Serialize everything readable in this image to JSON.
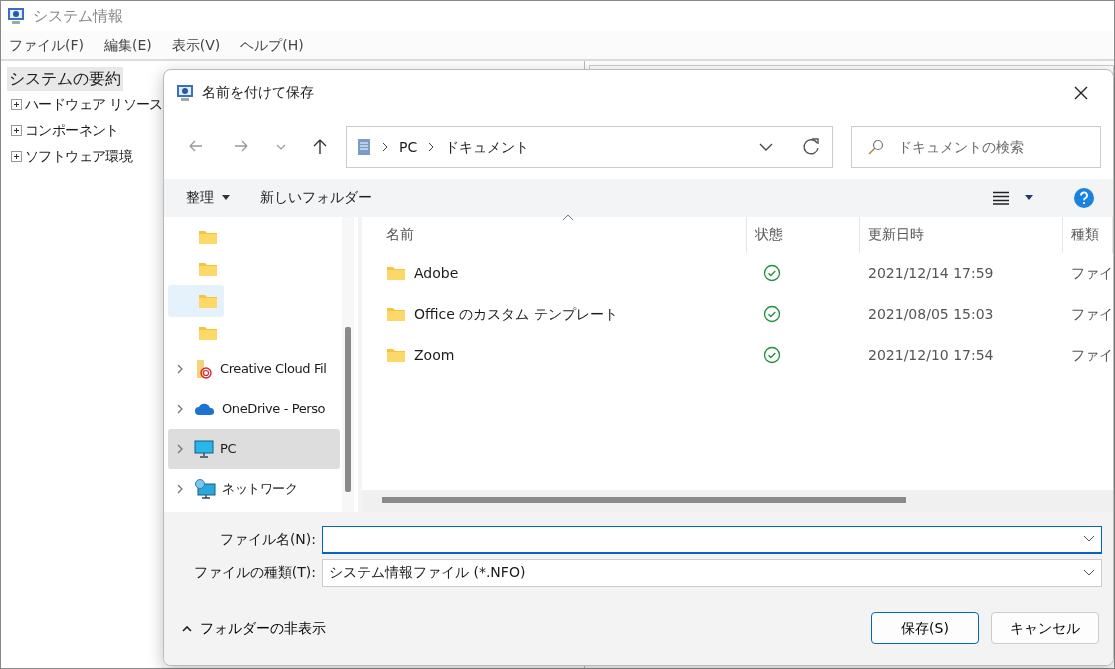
{
  "window": {
    "title": "システム情報"
  },
  "menu": [
    "ファイル(F)",
    "編集(E)",
    "表示(V)",
    "ヘルプ(H)"
  ],
  "tree": {
    "label": "システムの要約",
    "selected": true,
    "children": [
      {
        "label": "ハードウェア リソース",
        "expanded": false
      },
      {
        "label": "コンポーネント",
        "expanded": false
      },
      {
        "label": "ソフトウェア環境",
        "expanded": false
      }
    ]
  },
  "dialog": {
    "title": "名前を付けて保存",
    "address": [
      "PC",
      "ドキュメント"
    ],
    "search": {
      "placeholder": "ドキュメントの検索"
    },
    "toolbar": {
      "organize": "整理",
      "new_folder": "新しいフォルダー"
    },
    "nav": [
      {
        "kind": "folder",
        "selected": false
      },
      {
        "kind": "folder",
        "selected": false
      },
      {
        "kind": "folder",
        "selected": true
      },
      {
        "kind": "folder",
        "selected": false
      },
      {
        "kind": "cloudfiles",
        "label": "Creative Cloud Fil",
        "expanded": false,
        "selected": false
      },
      {
        "kind": "onedrive",
        "label": "OneDrive - Perso",
        "expanded": false,
        "selected": false
      },
      {
        "kind": "pc",
        "label": "PC",
        "expanded": false,
        "selected": true
      },
      {
        "kind": "network",
        "label": "ネットワーク",
        "expanded": false,
        "selected": false
      }
    ],
    "columns": [
      {
        "label": "名前",
        "sorted": true
      },
      {
        "label": "状態",
        "sorted": false
      },
      {
        "label": "更新日時",
        "sorted": false
      },
      {
        "label": "種類",
        "sorted": false
      }
    ],
    "files": [
      {
        "name": "Adobe",
        "synced": true,
        "modified": "2021/12/14 17:59",
        "type": "ファイ"
      },
      {
        "name": "Office のカスタム テンプレート",
        "synced": true,
        "modified": "2021/08/05 15:03",
        "type": "ファイ"
      },
      {
        "name": "Zoom",
        "synced": true,
        "modified": "2021/12/10 17:54",
        "type": "ファイ"
      }
    ],
    "file_name_label": "ファイル名(N):",
    "file_type_label": "ファイルの種類(T):",
    "file_type": "システム情報ファイル (*.NFO)",
    "hide_folders": "フォルダーの非表示",
    "buttons": [
      {
        "label": "保存(S)",
        "primary": true
      },
      {
        "label": "キャンセル",
        "primary": false
      }
    ]
  }
}
